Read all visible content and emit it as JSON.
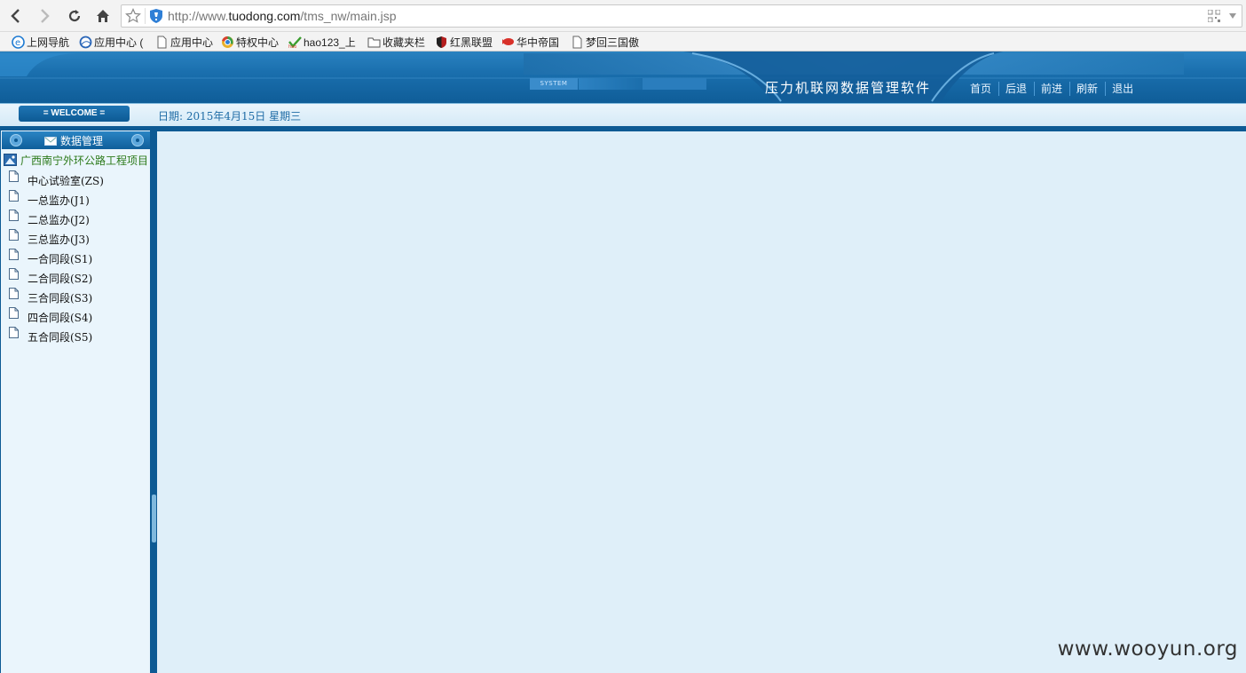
{
  "browser": {
    "url_prefix": "http://www.",
    "url_host": "tuodong.com",
    "url_path": "/tms_nw/main.jsp",
    "bookmarks": [
      {
        "label": "上网导航",
        "icon": "ie-e-icon"
      },
      {
        "label": "应用中心 (",
        "icon": "globe-icon"
      },
      {
        "label": "应用中心",
        "icon": "page-icon"
      },
      {
        "label": "特权中心",
        "icon": "chrome-icon"
      },
      {
        "label": "hao123_上",
        "icon": "hao-icon"
      },
      {
        "label": "收藏夹栏",
        "icon": "folder-icon"
      },
      {
        "label": "红黑联盟",
        "icon": "shield-red-icon"
      },
      {
        "label": "华中帝国",
        "icon": "red-fish-icon"
      },
      {
        "label": "梦回三国傲",
        "icon": "page-icon"
      }
    ]
  },
  "header": {
    "system_tag": "SYSTEM",
    "app_title": "压力机联网数据管理软件",
    "nav": [
      "首页",
      "后退",
      "前进",
      "刷新",
      "退出"
    ]
  },
  "infobar": {
    "welcome": "= WELCOME =",
    "date": "日期: 2015年4月15日  星期三"
  },
  "sidebar": {
    "panel_title": "数据管理",
    "root": "广西南宁外环公路工程项目",
    "items": [
      "中心试验室(ZS)",
      "一总监办(J1)",
      "二总监办(J2)",
      "三总监办(J3)",
      "一合同段(S1)",
      "二合同段(S2)",
      "三合同段(S3)",
      "四合同段(S4)",
      "五合同段(S5)"
    ]
  },
  "watermark": "www.wooyun.org",
  "colors": {
    "header_blue": "#1a6fae",
    "dark_blue": "#0d5a94",
    "panel_bg": "#eaf5fc",
    "content_bg": "#dfeff9",
    "root_green": "#2c7a1a"
  }
}
